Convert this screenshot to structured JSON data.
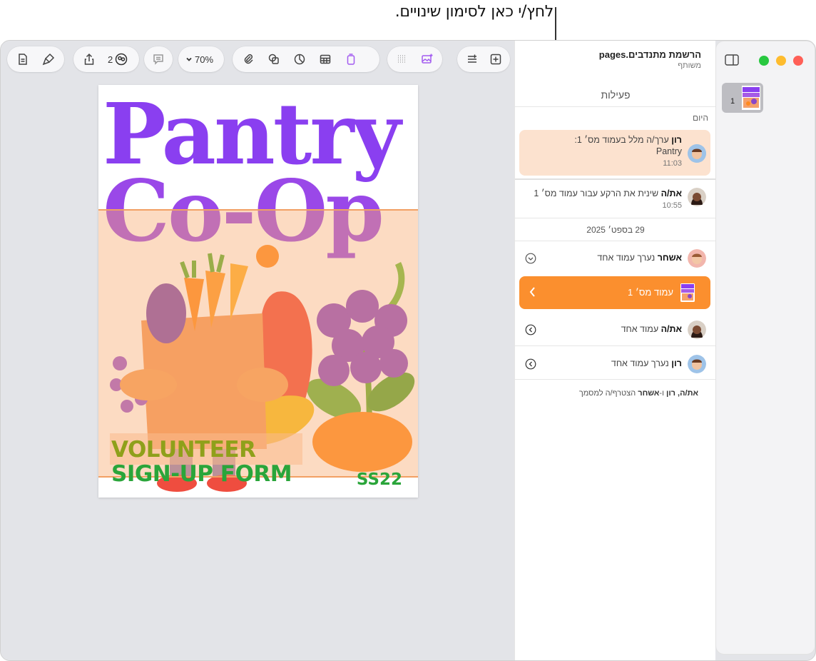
{
  "callout": {
    "text": "לחץ/י כאן לסימון שינויים."
  },
  "toolbar": {
    "collaborators_count": "2",
    "zoom": "70%"
  },
  "poster": {
    "title_line1": "Pantry",
    "title_line2": "Co-Op",
    "subtitle_line1": "VOLUNTEER",
    "subtitle_line2": "SIGN-UP FORM",
    "code": "SS22"
  },
  "activity": {
    "doc_title": "הרשמת מתנדבים.pages",
    "doc_subtitle": "משותף",
    "tab_label": "פעילות",
    "today_label": "היום",
    "entries": [
      {
        "user": "רון",
        "action": "ערך/ה מלל בעמוד מס׳ 1:",
        "detail": "Pantry",
        "time": "11:03"
      },
      {
        "user": "את/ה",
        "action": "שינית את הרקע עבור עמוד מס׳ 1",
        "time": "10:55"
      }
    ],
    "date_divider": "29 בספט׳ 2025",
    "asher_entry": {
      "user": "אשחר",
      "action": "נערך עמוד אחד"
    },
    "page_row_label": "עמוד מס׳ 1",
    "you_entry": {
      "user": "את/ה",
      "action": "עמוד אחד"
    },
    "ron_entry": {
      "user": "רון",
      "action": "נערך עמוד אחד"
    },
    "footer": {
      "names": "את/ה, רון",
      "joiner": "ו-",
      "last_name": "אשחר",
      "suffix": "הצטרף/ה למסמך"
    }
  },
  "sidebar": {
    "page_number": "1"
  },
  "colors": {
    "accent_orange": "#fb8f2e",
    "highlight_peach": "#fce2cf",
    "title_purple": "#8a3ff0",
    "close": "#ff5f57",
    "minimize": "#febc2e",
    "zoom": "#28c840"
  }
}
